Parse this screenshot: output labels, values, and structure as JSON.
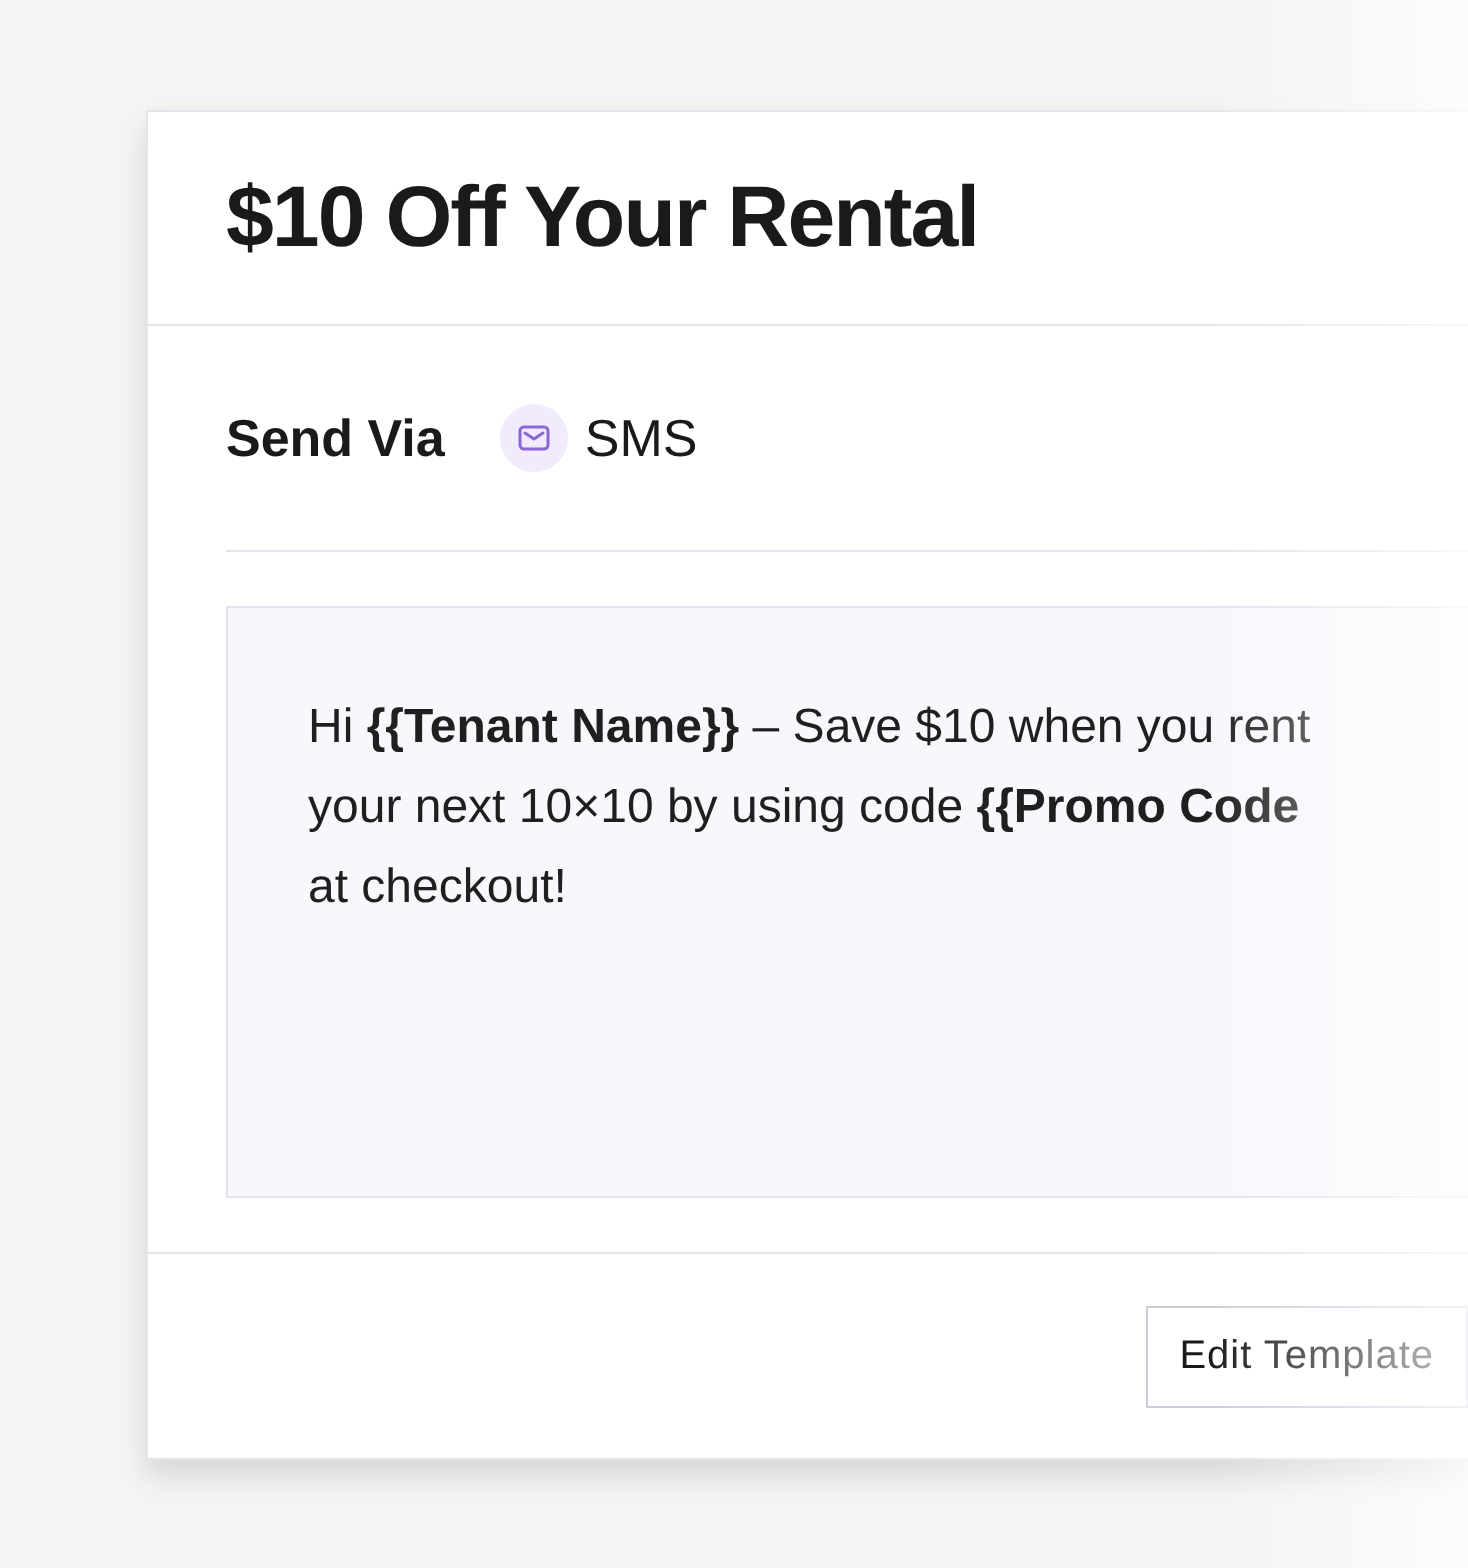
{
  "card": {
    "title": "$10 Off Your Rental",
    "send_via": {
      "label": "Send Via",
      "channel": "SMS"
    },
    "message": {
      "lines": [
        "Hi **{{Tenant Name}}** – Save $10 when you rent",
        "your next 10×10 by using code **{{Promo Code**",
        "at checkout!"
      ]
    },
    "actions": [
      {
        "label": "Edit Template"
      }
    ]
  }
}
